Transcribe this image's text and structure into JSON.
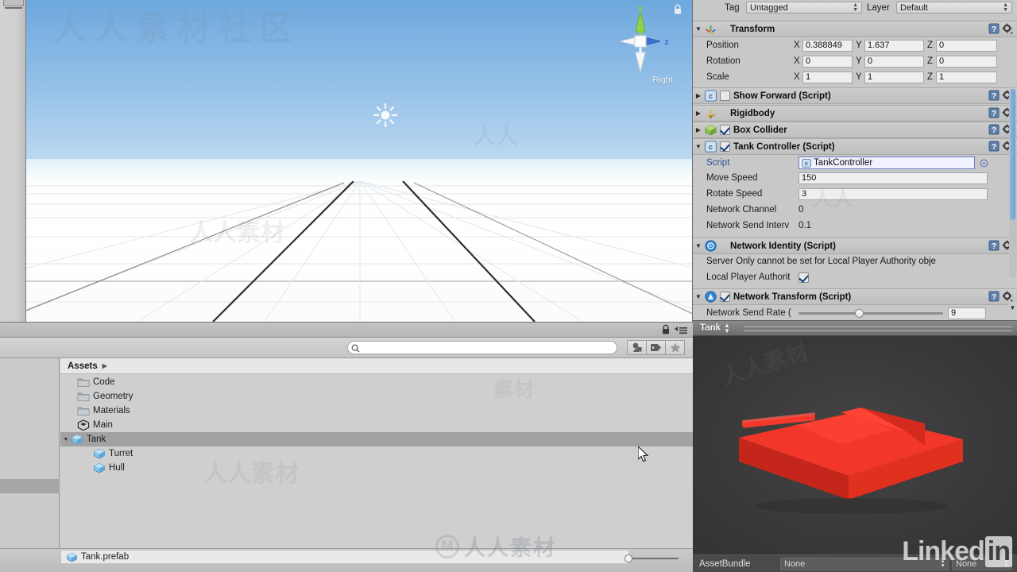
{
  "scene": {
    "gizmo": {
      "y_label": "y",
      "z_label": "z",
      "view_label": "Right",
      "lock_icon": "lock-icon"
    },
    "light_gizmo": "directional-light-icon"
  },
  "project": {
    "search": {
      "value": "",
      "placeholder": ""
    },
    "toolbar_icons": [
      "filter-by-type-icon",
      "filter-by-label-icon",
      "favorites-star-icon",
      "lock-icon",
      "panel-menu-icon"
    ],
    "breadcrumb": "Assets",
    "rows": [
      {
        "label": "Code",
        "icon": "folder-icon",
        "indent": 1,
        "foldout": "",
        "selected": false
      },
      {
        "label": "Geometry",
        "icon": "folder-icon",
        "indent": 1,
        "foldout": "",
        "selected": false
      },
      {
        "label": "Materials",
        "icon": "folder-icon",
        "indent": 1,
        "foldout": "",
        "selected": false
      },
      {
        "label": "Main",
        "icon": "unity-scene-icon",
        "indent": 1,
        "foldout": "",
        "selected": false
      },
      {
        "label": "Tank",
        "icon": "prefab-icon",
        "indent": 1,
        "foldout": "▼",
        "selected": true
      },
      {
        "label": "Turret",
        "icon": "prefab-icon",
        "indent": 2,
        "foldout": "",
        "selected": false
      },
      {
        "label": "Hull",
        "icon": "prefab-icon",
        "indent": 2,
        "foldout": "",
        "selected": false
      }
    ],
    "footer_item": {
      "label": "Tank.prefab",
      "icon": "prefab-icon"
    },
    "zoom_slider": {
      "value": 8
    }
  },
  "inspector": {
    "tag": {
      "label": "Tag",
      "value": "Untagged"
    },
    "layer": {
      "label": "Layer",
      "value": "Default"
    },
    "transform": {
      "title": "Transform",
      "icon": "transform-icon",
      "rows": [
        {
          "label": "Position",
          "x": "0.388849",
          "y": "1.637",
          "z": "0"
        },
        {
          "label": "Rotation",
          "x": "0",
          "y": "0",
          "z": "0"
        },
        {
          "label": "Scale",
          "x": "1",
          "y": "1",
          "z": "1"
        }
      ],
      "axis_labels": [
        "X",
        "Y",
        "Z"
      ]
    },
    "components": [
      {
        "title": "Show Forward (Script)",
        "icon": "cs-script-icon",
        "checkbox": "off",
        "foldout": "▶",
        "has_checkbox": true
      },
      {
        "title": "Rigidbody",
        "icon": "rigidbody-icon",
        "checkbox": "none",
        "foldout": "▶",
        "has_checkbox": false
      },
      {
        "title": "Box Collider",
        "icon": "collider-icon",
        "checkbox": "on",
        "foldout": "▶",
        "has_checkbox": true
      },
      {
        "title": "Tank Controller (Script)",
        "icon": "cs-script-icon",
        "checkbox": "on",
        "foldout": "▼",
        "has_checkbox": true
      }
    ],
    "tank_controller": {
      "script": {
        "label": "Script",
        "value": "TankController",
        "icon": "cs-script-icon"
      },
      "move_speed": {
        "label": "Move Speed",
        "value": "150"
      },
      "rotate_speed": {
        "label": "Rotate Speed",
        "value": "3"
      },
      "network_channel": {
        "label": "Network Channel",
        "value": "0"
      },
      "network_send_interval": {
        "label": "Network Send Interv",
        "value": "0.1"
      }
    },
    "network_identity": {
      "title": "Network Identity (Script)",
      "icon": "network-identity-icon",
      "foldout": "▼",
      "help_text": "Server Only cannot be set for Local Player Authority obje",
      "local_player_authority": {
        "label": "Local Player Authorit",
        "checked": true
      }
    },
    "network_transform": {
      "title": "Network Transform (Script)",
      "icon": "network-transform-icon",
      "foldout": "▼",
      "has_checkbox": true,
      "checkbox": "on",
      "send_rate": {
        "label": "Network Send Rate (",
        "value": "9",
        "slider_pct": 41
      }
    },
    "header_tools": [
      "help-icon",
      "gear-icon"
    ]
  },
  "preview": {
    "title": "Tank",
    "dropdown_icon": "updown-arrows-icon",
    "model": "red-tank-model",
    "assetbundle": {
      "label": "AssetBundle",
      "name": "None",
      "variant": "None"
    }
  },
  "watermarks": {
    "linkedin": "Linkedin",
    "center_text": "人人素材",
    "center_mark": "M",
    "cn_top": "人人素材社区"
  },
  "colors": {
    "unity_panel_bg": "#c8c8c8",
    "selection": "#a2a2a2",
    "tank_red": "#ee3124",
    "scrollbar_blue": "#7ba7d8",
    "objfield_border": "#6e7fbf"
  }
}
